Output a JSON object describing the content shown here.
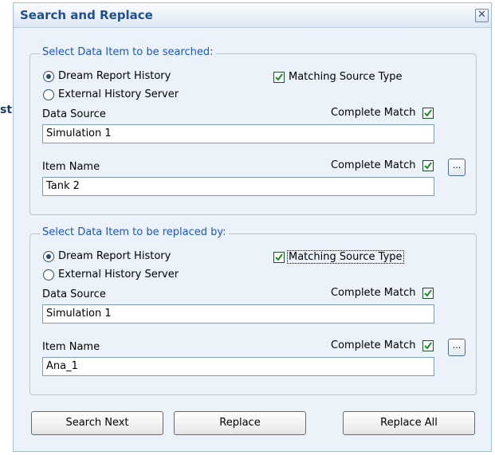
{
  "background": {
    "clipped_text": "st"
  },
  "window": {
    "title": "Search and Replace",
    "close_glyph": "✕"
  },
  "search_group": {
    "legend": "Select Data Item to be searched:",
    "radio_dream": "Dream Report History",
    "radio_external": "External History Server",
    "selected_source": "Dream Report History",
    "matching_source_type": {
      "label": "Matching Source Type",
      "checked": true
    },
    "data_source": {
      "label": "Data Source",
      "value": "Simulation 1",
      "complete_match_label": "Complete Match",
      "complete_match_checked": true
    },
    "item_name": {
      "label": "Item Name",
      "value": "Tank 2",
      "complete_match_label": "Complete Match",
      "complete_match_checked": true,
      "browse_label": "..."
    }
  },
  "replace_group": {
    "legend": "Select Data Item to be replaced by:",
    "radio_dream": "Dream Report History",
    "radio_external": "External History Server",
    "selected_source": "Dream Report History",
    "matching_source_type": {
      "label": "Matching Source Type",
      "checked": true
    },
    "data_source": {
      "label": "Data Source",
      "value": "Simulation 1",
      "complete_match_label": "Complete Match",
      "complete_match_checked": true
    },
    "item_name": {
      "label": "Item Name",
      "value": "Ana_1",
      "complete_match_label": "Complete Match",
      "complete_match_checked": true,
      "browse_label": "..."
    }
  },
  "buttons": {
    "search_next": "Search Next",
    "replace": "Replace",
    "replace_all": "Replace All"
  },
  "colors": {
    "title_text": "#1f4f8c",
    "legend_text": "#1b55c4",
    "dialog_bg": "#ecf2f9",
    "check_mark": "#1f8a2a"
  }
}
